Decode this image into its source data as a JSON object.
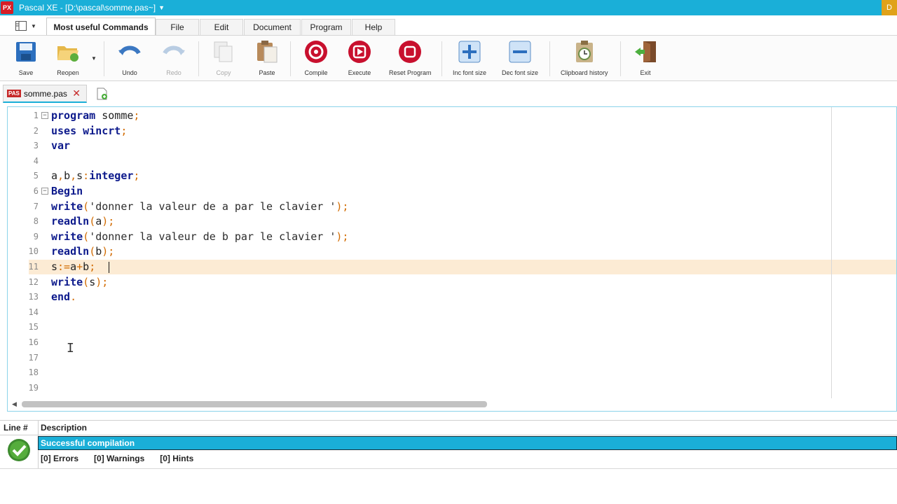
{
  "window": {
    "app_logo": "PX",
    "title": "Pascal XE  -  [D:\\pascal\\somme.pas~]",
    "title_menu_icon": "chevron-down-icon",
    "corner_badge": "D"
  },
  "ribbon_tabs": [
    {
      "label": "Most useful Commands",
      "active": true
    },
    {
      "label": "File",
      "active": false
    },
    {
      "label": "Edit",
      "active": false
    },
    {
      "label": "Document",
      "active": false
    },
    {
      "label": "Program",
      "active": false
    },
    {
      "label": "Help",
      "active": false
    }
  ],
  "toolbar": {
    "save": "Save",
    "reopen": "Reopen",
    "undo": "Undo",
    "redo": "Redo",
    "copy": "Copy",
    "paste": "Paste",
    "compile": "Compile",
    "execute": "Execute",
    "reset": "Reset Program",
    "inc_font": "Inc font size",
    "dec_font": "Dec font size",
    "clipboard": "Clipboard history",
    "exit": "Exit"
  },
  "file_tab": {
    "badge": "PAS",
    "name": "somme.pas",
    "close": "✕"
  },
  "editor": {
    "line_numbers": [
      "1",
      "2",
      "3",
      "4",
      "5",
      "6",
      "7",
      "8",
      "9",
      "10",
      "11",
      "12",
      "13",
      "14",
      "15",
      "16",
      "17",
      "18",
      "19"
    ],
    "current_line": 11,
    "code": {
      "l1_kw": "program",
      "l1_rest": " somme",
      "l1_sym": ";",
      "l2_kw": "uses",
      "l2_kw2": " wincrt",
      "l2_sym": ";",
      "l3_kw": "var",
      "l5_a": "a",
      "l5_c1": ",",
      "l5_b": "b",
      "l5_c2": ",",
      "l5_s": "s",
      "l5_colon": ":",
      "l5_kw": "integer",
      "l5_sym": ";",
      "l6_kw": "Begin",
      "l7_kw": "write",
      "l7_open": "(",
      "l7_str": "'donner la valeur de a par le clavier '",
      "l7_close": ");",
      "l8_kw": "readln",
      "l8_open": "(",
      "l8_arg": "a",
      "l8_close": ");",
      "l9_kw": "write",
      "l9_open": "(",
      "l9_str": "'donner la valeur de b par le clavier '",
      "l9_close": ");",
      "l10_kw": "readln",
      "l10_open": "(",
      "l10_arg": "b",
      "l10_close": ");",
      "l11_s": "s",
      "l11_assign": ":=",
      "l11_a": "a",
      "l11_plus": "+",
      "l11_b": "b",
      "l11_sym": ";",
      "l12_kw": "write",
      "l12_open": "(",
      "l12_arg": "s",
      "l12_close": ");",
      "l13_kw": "end",
      "l13_sym": "."
    }
  },
  "messages": {
    "col_line": "Line #",
    "col_desc": "Description",
    "status": "Successful compilation",
    "errors": "[0] Errors",
    "warnings": "[0] Warnings",
    "hints": "[0] Hints"
  }
}
